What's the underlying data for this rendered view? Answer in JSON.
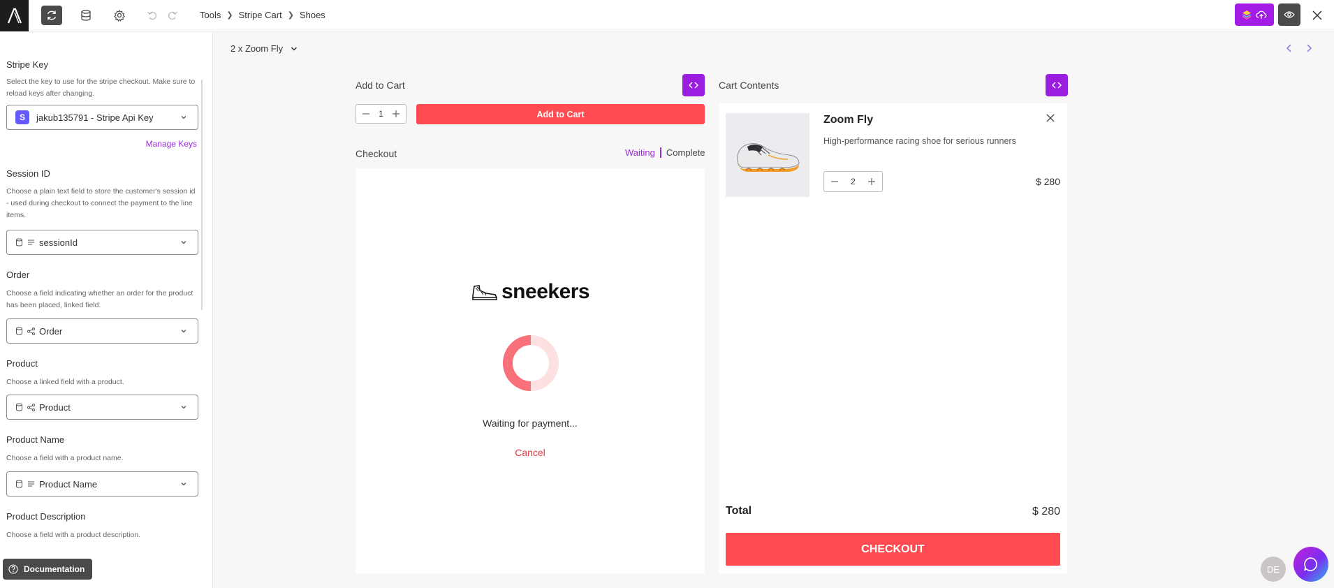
{
  "app": {
    "logo_alt": "A"
  },
  "toolbar": {
    "refresh_icon": "refresh-icon",
    "database_icon": "database-icon",
    "settings_icon": "gear-icon",
    "undo_icon": "undo-icon",
    "redo_icon": "redo-icon"
  },
  "breadcrumb": [
    "Tools",
    "Stripe Cart",
    "Shoes"
  ],
  "sidebar": {
    "stripe_key": {
      "label": "Stripe Key",
      "description": "Select the key to use for the stripe checkout. Make sure to reload keys after changing.",
      "value": "jakub135791 - Stripe Api Key",
      "manage_label": "Manage Keys"
    },
    "session_id": {
      "label": "Session ID",
      "description": "Choose a plain text field to store the customer's session id - used during checkout to connect the payment to the line items.",
      "value": "sessionId"
    },
    "order": {
      "label": "Order",
      "description": "Choose a field indicating whether an order for the product has been placed, linked field.",
      "value": "Order"
    },
    "product": {
      "label": "Product",
      "description": "Choose a linked field with a product.",
      "value": "Product"
    },
    "product_name": {
      "label": "Product Name",
      "description": "Choose a field with a product name.",
      "value": "Product Name"
    },
    "product_description": {
      "label": "Product Description",
      "description": "Choose a field with a product description."
    },
    "documentation_label": "Documentation"
  },
  "main": {
    "variant_selector": "2 x Zoom Fly",
    "add_to_cart": {
      "title": "Add to Cart",
      "quantity": "1",
      "button_label": "Add to Cart"
    },
    "checkout": {
      "title": "Checkout",
      "tab_waiting": "Waiting",
      "tab_complete": "Complete",
      "brand": "sneekers",
      "status_text": "Waiting for payment...",
      "cancel_label": "Cancel"
    },
    "cart": {
      "title": "Cart Contents",
      "item": {
        "name": "Zoom Fly",
        "description": "High-performance racing shoe for serious runners",
        "quantity": "2",
        "price": "$ 280"
      },
      "total_label": "Total",
      "total_value": "$ 280",
      "checkout_label": "CHECKOUT"
    }
  },
  "footer": {
    "avatar_initials": "DE"
  },
  "colors": {
    "accent": "#9a1de0",
    "primary_button": "#ff4c52",
    "stripe": "#635bff"
  }
}
